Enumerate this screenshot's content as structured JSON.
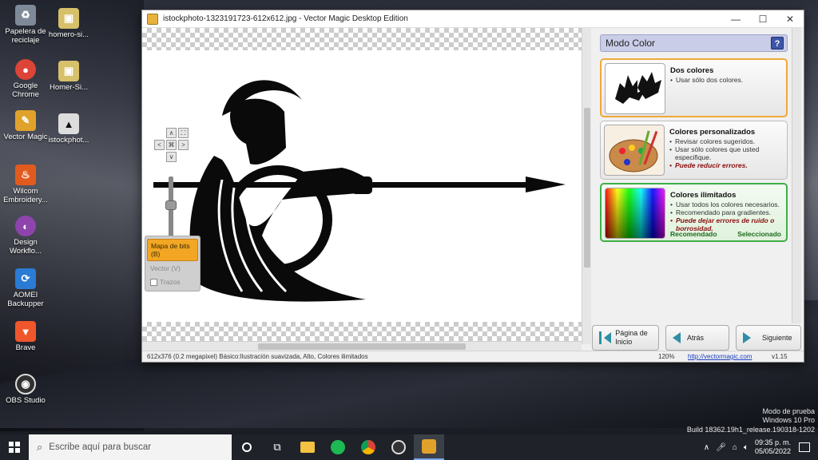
{
  "desktop": {
    "icons": [
      {
        "label": "Papelera de reciclaje",
        "color": "#7f8a99"
      },
      {
        "label": "homero-si...",
        "color": "#d6c06a"
      },
      {
        "label": "Google Chrome",
        "color": "#db4437"
      },
      {
        "label": "Homer-Si...",
        "color": "#d6c06a"
      },
      {
        "label": "Vector Magic",
        "color": "#e0a22a"
      },
      {
        "label": "istockphot...",
        "color": "#555555"
      },
      {
        "label": "Wilcom Embroidery...",
        "color": "#e25b1e"
      },
      {
        "label": "Design Workflo...",
        "color": "#8e44ad"
      },
      {
        "label": "AOMEI Backupper",
        "color": "#2a7bd4"
      },
      {
        "label": "Brave",
        "color": "#f0562c"
      },
      {
        "label": "OBS Studio",
        "color": "#303030"
      }
    ],
    "watermark": {
      "line1": "Modo de prueba",
      "line2": "Windows 10 Pro",
      "line3": "Build 18362.19h1_release.190318-1202"
    }
  },
  "window": {
    "title": "istockphoto-1323191723-612x612.jpg - Vector Magic Desktop Edition",
    "controls": {
      "minimize": "—",
      "maximize": "☐",
      "close": "✕"
    },
    "nav_buttons": {
      "up": "∧",
      "down": "∨",
      "left": "<",
      "right": ">",
      "center": "⌘",
      "fit": "⛶"
    },
    "modes": {
      "bitmap": "Mapa de bits (B)",
      "vector": "Vector (V)",
      "traces": "Trazos"
    },
    "panel": {
      "title": "Modo Color",
      "help": "?",
      "options": [
        {
          "title": "Dos colores",
          "bullets": [
            "Usar sólo dos colores."
          ],
          "emphasis": ""
        },
        {
          "title": "Colores personalizados",
          "bullets": [
            "Revisar colores sugeridos.",
            "Usar sólo colores que usted especifique."
          ],
          "emphasis": "Puede reducir errores."
        },
        {
          "title": "Colores ilimitados",
          "bullets": [
            "Usar todos los colores necesarios.",
            "Recomendado para gradientes."
          ],
          "emphasis": "Puede dejar errores de ruido o borrosidad.",
          "recommended": "Recomendado",
          "selected": "Seleccionado"
        }
      ]
    },
    "buttons": {
      "home": "Página de Inicio",
      "back": "Atrás",
      "next": "Siguiente"
    },
    "status": {
      "info": "612x376 (0.2 megapixel)  Básico:Ilustración suavizada, Alto, Colores ilimitados",
      "zoom": "120%",
      "url": "http://vectormagic.com",
      "version": "v1.15"
    }
  },
  "taskbar": {
    "search_placeholder": "Escribe aquí para buscar",
    "time": "09:35 p. m.",
    "date": "05/05/2022"
  }
}
